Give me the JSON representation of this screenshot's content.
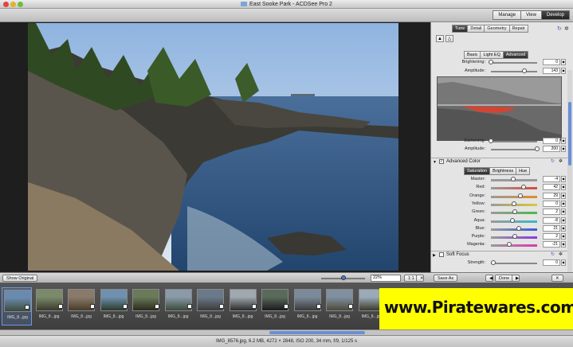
{
  "window": {
    "title": "East Sooke Park - ACDSee Pro 2"
  },
  "modes": [
    {
      "label": "Manage",
      "active": false
    },
    {
      "label": "View",
      "active": false
    },
    {
      "label": "Develop",
      "active": true
    }
  ],
  "panel": {
    "tabs": [
      {
        "label": "Tune",
        "active": true
      },
      {
        "label": "Detail",
        "active": false
      },
      {
        "label": "Geometry",
        "active": false
      },
      {
        "label": "Repair",
        "active": false
      }
    ],
    "tune_tabs": [
      {
        "label": "Basic",
        "active": false
      },
      {
        "label": "Light EQ",
        "active": false
      },
      {
        "label": "Advanced",
        "active": true
      }
    ],
    "brightening": {
      "label": "Brightening:",
      "value": "0",
      "fraction": 0.0
    },
    "amplitude_top": {
      "label": "Amplitude:",
      "value": "143",
      "fraction": 0.72
    },
    "darkening": {
      "label": "Darkening:",
      "value": "0",
      "fraction": 0.0
    },
    "amplitude_bottom": {
      "label": "Amplitude:",
      "value": "200",
      "fraction": 1.0
    },
    "advanced_color": {
      "title": "Advanced Color",
      "tabs": [
        {
          "label": "Saturation",
          "active": true
        },
        {
          "label": "Brightness",
          "active": false
        },
        {
          "label": "Hue",
          "active": false
        }
      ],
      "rows": [
        {
          "label": "Master:",
          "value": "-4",
          "fraction": 0.48,
          "color": "#9a9a9a"
        },
        {
          "label": "Red:",
          "value": "42",
          "fraction": 0.71,
          "color": "#d94a3a"
        },
        {
          "label": "Orange:",
          "value": "29",
          "fraction": 0.64,
          "color": "#e38b2c"
        },
        {
          "label": "Yellow:",
          "value": "0",
          "fraction": 0.5,
          "color": "#d9c93a"
        },
        {
          "label": "Green:",
          "value": "2",
          "fraction": 0.51,
          "color": "#4ab84a"
        },
        {
          "label": "Aqua:",
          "value": "-8",
          "fraction": 0.46,
          "color": "#3ab8c4"
        },
        {
          "label": "Blue:",
          "value": "21",
          "fraction": 0.6,
          "color": "#3a5ad9"
        },
        {
          "label": "Purple:",
          "value": "2",
          "fraction": 0.51,
          "color": "#8a3ad9"
        },
        {
          "label": "Magenta:",
          "value": "-21",
          "fraction": 0.4,
          "color": "#d93ab0"
        }
      ]
    },
    "soft_focus": {
      "title": "Soft Focus",
      "strength_label": "Strength:",
      "strength_value": "0"
    },
    "save_as": "Save As",
    "done": "Done"
  },
  "bottombar": {
    "show_original": "Show Original",
    "zoom": "22%",
    "fit_label": "1:1"
  },
  "filmstrip": {
    "thumbs": [
      {
        "caption": "IMG_8...jpg",
        "selected": true
      },
      {
        "caption": "IMG_8...jpg",
        "selected": false
      },
      {
        "caption": "IMG_8...jpg",
        "selected": false
      },
      {
        "caption": "IMG_8...jpg",
        "selected": false
      },
      {
        "caption": "IMG_8...jpg",
        "selected": false
      },
      {
        "caption": "IMG_8...jpg",
        "selected": false
      },
      {
        "caption": "IMG_8...jpg",
        "selected": false
      },
      {
        "caption": "IMG_8...jpg",
        "selected": false
      },
      {
        "caption": "IMG_8...jpg",
        "selected": false
      },
      {
        "caption": "IMG_8...jpg",
        "selected": false
      },
      {
        "caption": "IMG_8...jpg",
        "selected": false
      },
      {
        "caption": "IMG_8...jpg",
        "selected": false
      }
    ]
  },
  "watermark": {
    "text": "www.Piratewares.com"
  },
  "status": {
    "text": "IMG_8576.jpg, 6.2 MB, 4272 × 2848, ISO 200, 34 mm, f/9, 1/125 s"
  },
  "colors": {
    "accent": "#4a7ad8",
    "watermark_bg": "#ffff00"
  }
}
